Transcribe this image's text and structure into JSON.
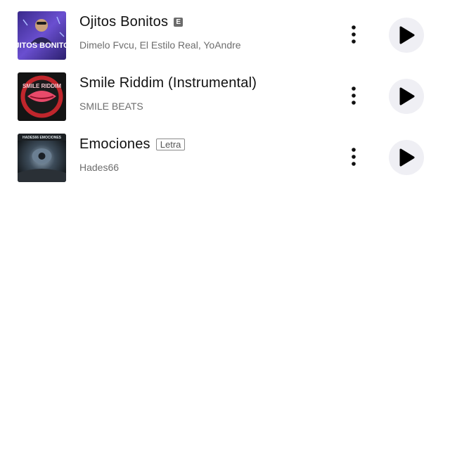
{
  "songs": [
    {
      "title": "Ojitos Bonitos",
      "badge": "E",
      "artists": "Dimelo Fvcu, El Estilo Real, YoAndre",
      "artwork_icon": "album-cover-purple-ojitos-bonitos",
      "artwork_text": "OJITOS BONITOS"
    },
    {
      "title": "Smile Riddim (Instrumental)",
      "artists": "SMILE BEATS",
      "artwork_icon": "album-cover-red-lips",
      "artwork_text": "SMILE RIDDIM"
    },
    {
      "title": "Emociones",
      "badge": "Letra",
      "artists": "Hades66",
      "artwork_icon": "album-cover-dark-eye",
      "artwork_text": "HADES66 EMOCIONES"
    }
  ],
  "icons": {
    "more": "more-vertical-icon",
    "play": "play-icon"
  },
  "colors": {
    "title": "#111111",
    "subtitle": "#6d6d6d",
    "play_bg": "#efeff4",
    "badge_bg": "#6b6b6b"
  }
}
